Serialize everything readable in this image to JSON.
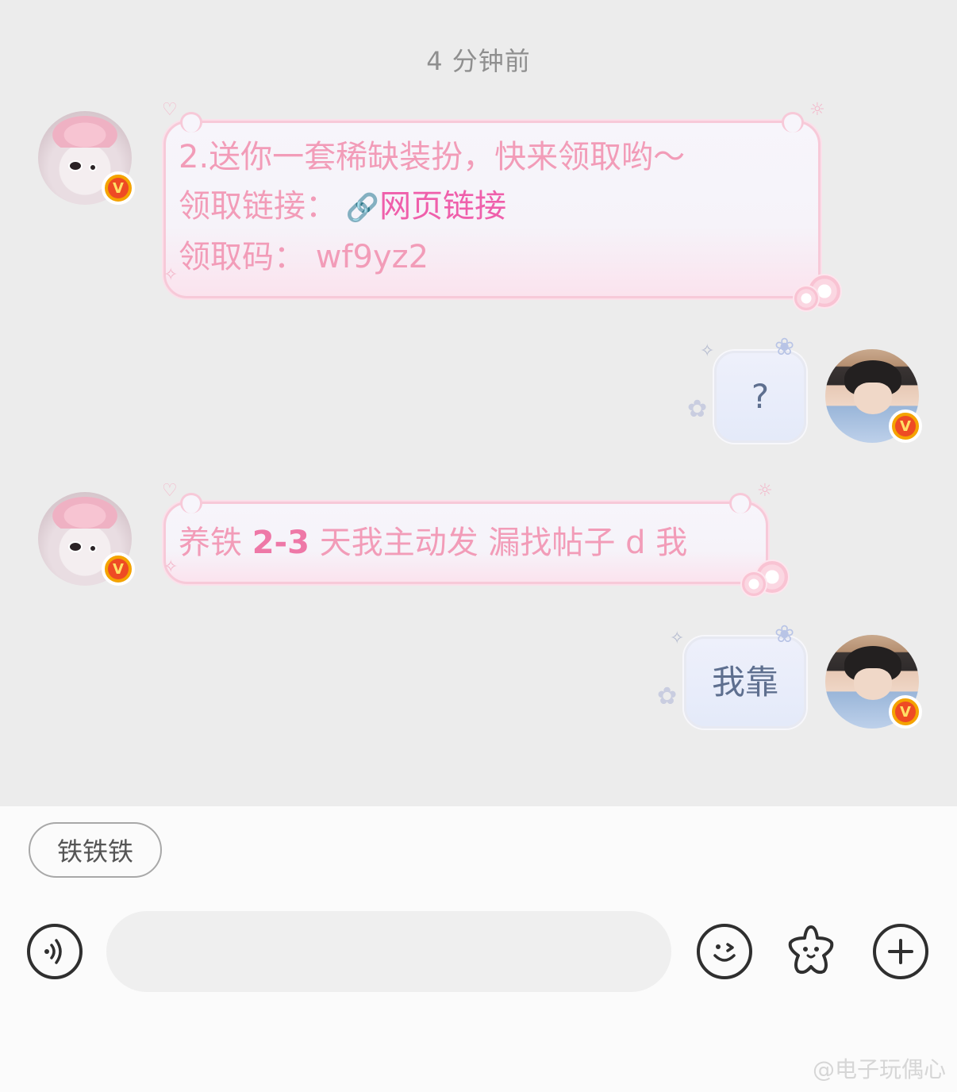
{
  "timestamp": "4 分钟前",
  "messages": {
    "m1": {
      "line1": "2.送你一套稀缺装扮，快来领取哟～",
      "line2_label": "领取链接：",
      "line2_link": "网页链接",
      "line3": "领取码：  wf9yz2"
    },
    "m2": {
      "text": "?"
    },
    "m3": {
      "part1": "养铁 ",
      "part_num": "2-3",
      "part2": " 天我主动发 漏找帖子 d 我"
    },
    "m4": {
      "text": "我靠"
    }
  },
  "badges": {
    "verified": "V"
  },
  "quick_reply": {
    "chip": "铁铁铁"
  },
  "watermark": "@电子玩偶心",
  "colors": {
    "chat_bg": "#ececec",
    "pink_text": "#f29cb8",
    "link": "#ef5fab",
    "blue_text": "#5e6f8f",
    "badge": "#f4a300"
  },
  "icons": {
    "voice": "voice-icon",
    "emoji": "emoji-icon",
    "star": "star-icon",
    "plus": "plus-icon",
    "link": "link-icon"
  }
}
